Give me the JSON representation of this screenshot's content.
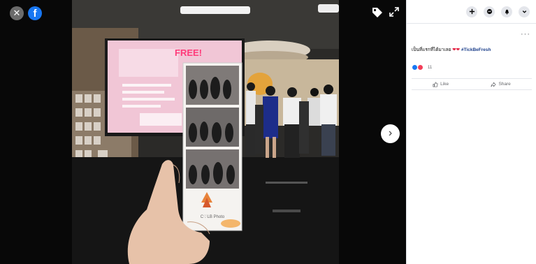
{
  "viewer": {
    "close_icon": "close-icon",
    "logo_icon": "facebook-logo",
    "logo_letter": "f",
    "tag_icon": "tag-icon",
    "expand_icon": "expand-icon",
    "next_icon": "chevron-right-icon",
    "photo_text": {
      "screen_sign": "FREE!",
      "booth_brand": "C♡LB Photo"
    }
  },
  "panel": {
    "header_icons": [
      "plus-icon",
      "messenger-icon",
      "notifications-icon",
      "account-menu-icon"
    ],
    "post_options": "···",
    "caption_text": "เป็นที่แรกที่ได้มาเลย",
    "caption_hearts": "❤❤",
    "caption_hashtag": "#TickBeFresh",
    "reaction_count": "11",
    "like_label": "Like",
    "share_label": "Share"
  },
  "colors": {
    "facebook_blue": "#1877f2",
    "love_red": "#f33e58",
    "panel_border": "#e4e6eb"
  }
}
